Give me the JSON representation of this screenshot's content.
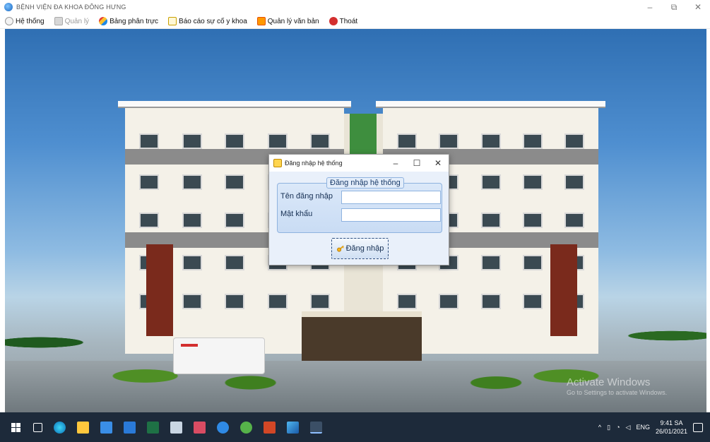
{
  "window": {
    "title": "BỆNH VIỆN ĐA KHOA ĐÔNG HƯNG",
    "minimize_glyph": "–",
    "restore_glyph": "⧉",
    "close_glyph": "✕"
  },
  "menu": {
    "items": [
      {
        "label": "Hệ thống",
        "icon": "system-icon",
        "enabled": true
      },
      {
        "label": "Quản lý",
        "icon": "manage-icon",
        "enabled": false
      },
      {
        "label": "Bảng phân trực",
        "icon": "duty-roster-icon",
        "enabled": true
      },
      {
        "label": "Báo cáo sự cố y khoa",
        "icon": "report-icon",
        "enabled": true
      },
      {
        "label": "Quản lý văn bản",
        "icon": "document-icon",
        "enabled": true
      },
      {
        "label": "Thoát",
        "icon": "exit-icon",
        "enabled": true
      }
    ]
  },
  "dialog": {
    "title": "Đăng nhập hệ thống",
    "group_title": "Đăng nhập hệ thống",
    "username_label": "Tên đăng nhập",
    "username_value": "",
    "password_label": "Mật khẩu",
    "password_value": "",
    "login_button": "Đăng nhập",
    "minimize_glyph": "–",
    "maximize_glyph": "☐",
    "close_glyph": "✕"
  },
  "watermark": {
    "title": "Activate Windows",
    "subtitle": "Go to Settings to activate Windows."
  },
  "taskbar": {
    "apps": [
      "start-icon",
      "task-view-icon",
      "edge-icon",
      "file-explorer-icon",
      "store-icon",
      "mail-icon",
      "excel-icon",
      "paint-icon",
      "network-app-icon",
      "zalo-icon",
      "green-app-icon",
      "powerpoint-icon",
      "photos-icon",
      "running-app-icon"
    ],
    "tray": {
      "chevron": "^",
      "language": "ENG",
      "time": "9:41 SA",
      "date": "26/01/2021"
    }
  },
  "colors": {
    "accent": "#1e88e5",
    "taskbar_bg": "#1d2a3a",
    "dialog_body": "#e9f0fa"
  }
}
